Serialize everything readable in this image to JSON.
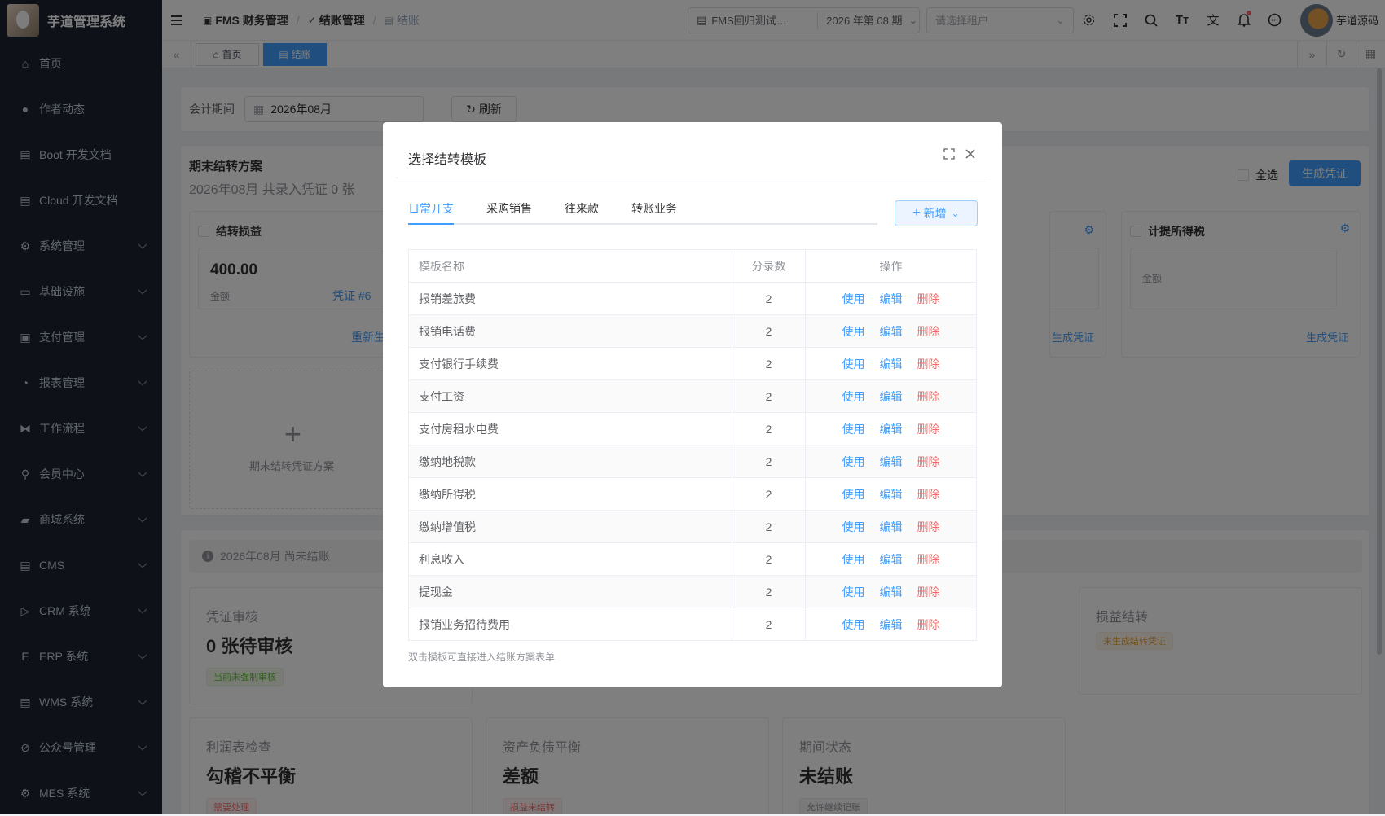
{
  "app": {
    "title": "芋道管理系统"
  },
  "sidebar": {
    "items": [
      {
        "label": "首页",
        "icon": "home-icon",
        "chevron": false
      },
      {
        "label": "作者动态",
        "icon": "user-icon",
        "chevron": false
      },
      {
        "label": "Boot 开发文档",
        "icon": "document-icon",
        "chevron": false
      },
      {
        "label": "Cloud 开发文档",
        "icon": "document-icon",
        "chevron": false
      },
      {
        "label": "系统管理",
        "icon": "gear-icon",
        "chevron": true
      },
      {
        "label": "基础设施",
        "icon": "monitor-icon",
        "chevron": true
      },
      {
        "label": "支付管理",
        "icon": "payment-icon",
        "chevron": true
      },
      {
        "label": "报表管理",
        "icon": "pie-chart-icon",
        "chevron": true
      },
      {
        "label": "工作流程",
        "icon": "flow-icon",
        "chevron": true
      },
      {
        "label": "会员中心",
        "icon": "bike-icon",
        "chevron": true
      },
      {
        "label": "商城系统",
        "icon": "shop-icon",
        "chevron": true
      },
      {
        "label": "CMS",
        "icon": "document-icon",
        "chevron": true
      },
      {
        "label": "CRM 系统",
        "icon": "crm-icon",
        "chevron": true
      },
      {
        "label": "ERP 系统",
        "icon": "erp-icon",
        "chevron": true
      },
      {
        "label": "WMS 系统",
        "icon": "warehouse-icon",
        "chevron": true
      },
      {
        "label": "公众号管理",
        "icon": "compass-icon",
        "chevron": true
      },
      {
        "label": "MES 系统",
        "icon": "gear-icon",
        "chevron": true
      }
    ]
  },
  "header": {
    "breadcrumb": [
      "FMS 财务管理",
      "结账管理",
      "结账"
    ],
    "ledger": "FMS回归测试…",
    "period": "2026 年第 08 期",
    "tenant_placeholder": "请选择租户",
    "username": "芋道源码"
  },
  "tags": {
    "home": "首页",
    "current": "结账"
  },
  "filter": {
    "label": "会计期间",
    "value": "2026年08月",
    "refresh": "刷新"
  },
  "scheme": {
    "title": "期末结转方案",
    "subtitle": "2026年08月 共录入凭证 0 张",
    "select_all": "全选",
    "generate": "生成凭证",
    "cards": [
      {
        "title": "结转损益",
        "amount": "400.00",
        "amount_label": "金额",
        "voucher": "凭证 #6",
        "action": "重新生"
      },
      {
        "title": "计提所得税",
        "amount_label": "金额",
        "action": "生成凭证"
      }
    ],
    "mid_action": "生成凭证",
    "add_label": "期末结转凭证方案"
  },
  "status": {
    "notice": "2026年08月 尚未结账",
    "cards": [
      {
        "title": "凭证审核",
        "value": "0 张待审核",
        "badge": "当前未强制审核"
      },
      {
        "title": "损益结转",
        "badge": "未生成结转凭证"
      },
      {
        "title": "利润表检查",
        "value": "勾稽不平衡",
        "badge": "需要处理"
      },
      {
        "title": "资产负债平衡",
        "value": "差额",
        "badge": "损益未结转"
      },
      {
        "title": "期间状态",
        "value": "未结账",
        "badge": "允许继续记账"
      }
    ]
  },
  "dialog": {
    "title": "选择结转模板",
    "tabs": [
      "日常开支",
      "采购销售",
      "往来款",
      "转账业务"
    ],
    "add_button": "新增",
    "columns": [
      "模板名称",
      "分录数",
      "操作"
    ],
    "actions": {
      "use": "使用",
      "edit": "编辑",
      "delete": "删除"
    },
    "rows": [
      {
        "name": "报销差旅费",
        "count": "2"
      },
      {
        "name": "报销电话费",
        "count": "2"
      },
      {
        "name": "支付银行手续费",
        "count": "2"
      },
      {
        "name": "支付工资",
        "count": "2"
      },
      {
        "name": "支付房租水电费",
        "count": "2"
      },
      {
        "name": "缴纳地税款",
        "count": "2"
      },
      {
        "name": "缴纳所得税",
        "count": "2"
      },
      {
        "name": "缴纳增值税",
        "count": "2"
      },
      {
        "name": "利息收入",
        "count": "2"
      },
      {
        "name": "提现金",
        "count": "2"
      },
      {
        "name": "报销业务招待费用",
        "count": "2"
      }
    ],
    "hint": "双击模板可直接进入结账方案表单"
  },
  "colors": {
    "primary": "#409eff",
    "danger": "#f56c6c",
    "sidebar": "#1e2230"
  }
}
